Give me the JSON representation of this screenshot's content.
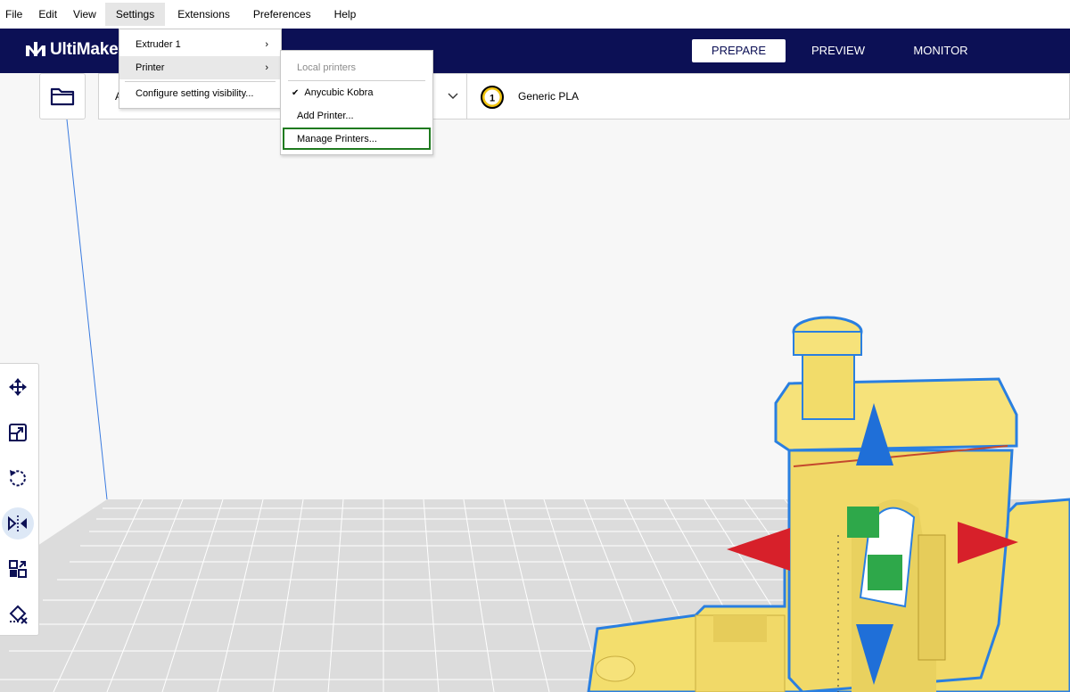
{
  "menubar": {
    "items": [
      {
        "label": "File"
      },
      {
        "label": "Edit"
      },
      {
        "label": "View"
      },
      {
        "label": "Settings"
      },
      {
        "label": "Extensions"
      },
      {
        "label": "Preferences"
      },
      {
        "label": "Help"
      }
    ]
  },
  "header": {
    "logo": "UltiMake",
    "stages": [
      "PREPARE",
      "PREVIEW",
      "MONITOR"
    ],
    "active_stage": "PREPARE"
  },
  "toolbar": {
    "printer_truncated": "A",
    "extruder_number": "1",
    "material": "Generic PLA"
  },
  "settings_menu": {
    "items": [
      {
        "label": "Extruder 1"
      },
      {
        "label": "Printer"
      },
      {
        "label": "Configure setting visibility..."
      }
    ]
  },
  "printer_submenu": {
    "section_header": "Local printers",
    "checked_printer": "Anycubic Kobra",
    "add_printer": "Add Printer...",
    "manage_printers": "Manage Printers..."
  },
  "colors": {
    "header_bg": "#0c1055",
    "model_yellow": "#f3de6d",
    "model_outline": "#2a7fe0",
    "arrow_red": "#d7202a",
    "arrow_blue": "#1f6fd8",
    "handle_green": "#2ea84a",
    "highlight_green": "#1f7a1f"
  }
}
